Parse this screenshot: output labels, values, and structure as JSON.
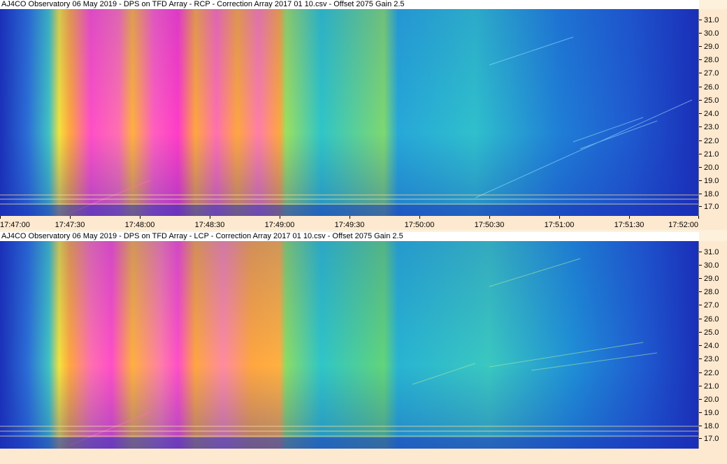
{
  "panels": [
    {
      "id": "rcp",
      "title": "AJ4CO Observatory 06 May 2019  -  DPS on TFD Array  -  RCP  -  Correction Array 2017 01 10.csv  -  Offset 2075  Gain 2.5"
    },
    {
      "id": "lcp",
      "title": "AJ4CO Observatory 06 May 2019  -  DPS on TFD Array  -  LCP  -  Correction Array 2017 01 10.csv  -  Offset 2075  Gain 2.5"
    }
  ],
  "y_ticks": [
    "31.0",
    "30.0",
    "29.0",
    "28.0",
    "27.0",
    "26.0",
    "25.0",
    "24.0",
    "23.0",
    "22.0",
    "21.0",
    "20.0",
    "19.0",
    "18.0",
    "17.0"
  ],
  "x_ticks": [
    "17:47:00",
    "17:47:30",
    "17:48:00",
    "17:48:30",
    "17:49:00",
    "17:49:30",
    "17:50:00",
    "17:50:30",
    "17:51:00",
    "17:51:30",
    "17:52:00"
  ],
  "colors": {
    "background_low": "#1a2fb8",
    "mid": "#22b8c8",
    "high": "#f6e23a",
    "orange": "#ffa640",
    "peak": "#ff3cc8",
    "axis_bg": "#fde9cf"
  }
}
